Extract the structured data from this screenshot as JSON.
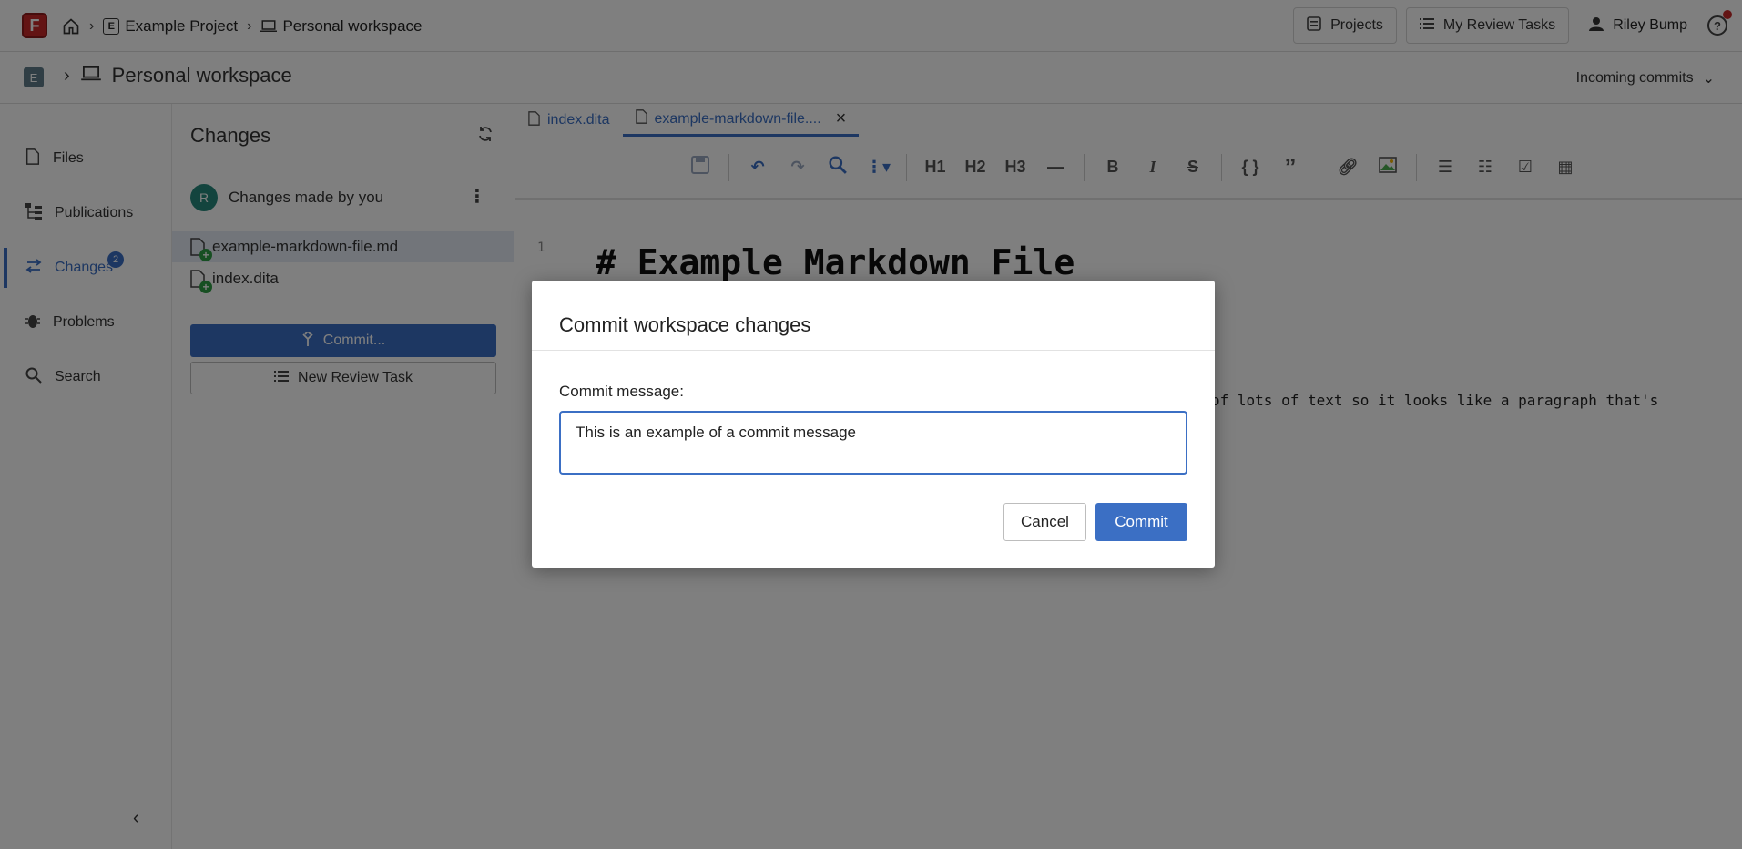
{
  "topbar": {
    "logo_letter": "F",
    "breadcrumbs": [
      {
        "badge": "E",
        "label": "Example Project"
      },
      {
        "label": "Personal workspace"
      }
    ],
    "projects_label": "Projects",
    "review_tasks_label": "My Review Tasks",
    "user_name": "Riley Bump",
    "help_glyph": "?"
  },
  "subbar": {
    "badge": "E",
    "title": "Personal workspace",
    "incoming_label": "Incoming commits"
  },
  "nav": {
    "items": [
      {
        "label": "Files",
        "icon": "file-icon"
      },
      {
        "label": "Publications",
        "icon": "publications-icon"
      },
      {
        "label": "Changes",
        "icon": "changes-icon",
        "badge": "2",
        "active": true
      },
      {
        "label": "Problems",
        "icon": "bug-icon"
      },
      {
        "label": "Search",
        "icon": "search-icon"
      }
    ]
  },
  "changes": {
    "title": "Changes",
    "user_initial": "R",
    "user_label": "Changes made by you",
    "files": [
      "example-markdown-file.md",
      "index.dita"
    ],
    "commit_label": "Commit...",
    "review_label": "New Review Task"
  },
  "editor": {
    "tabs": [
      {
        "label": "index.dita",
        "active": false
      },
      {
        "label": "example-markdown-file....",
        "active": true
      }
    ],
    "line_number": "1",
    "heading": "# Example Markdown File",
    "paragraph_fragment": "of lots of text so it looks like a paragraph that's",
    "toolbar": {
      "h1": "H1",
      "h2": "H2",
      "h3": "H3",
      "bold": "B",
      "italic": "I",
      "strike": "S",
      "code": "{ }",
      "quote": "”"
    }
  },
  "modal": {
    "title": "Commit workspace changes",
    "label": "Commit message:",
    "input_value": "This is an example of a commit message",
    "cancel_label": "Cancel",
    "commit_label": "Commit"
  }
}
